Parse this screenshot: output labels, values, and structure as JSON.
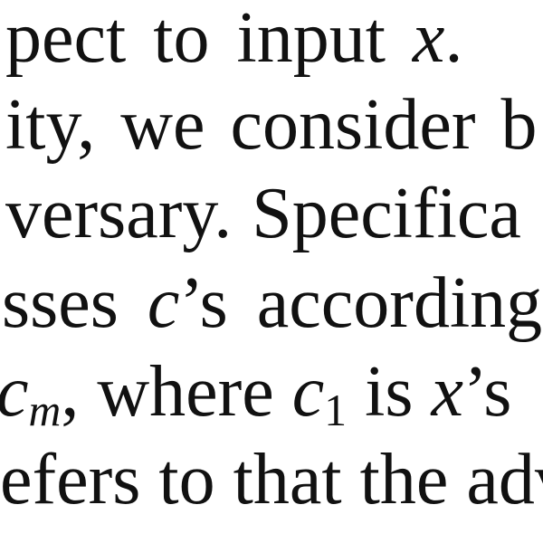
{
  "lines": [
    {
      "a": "pect to input ",
      "b": "x",
      "c": "."
    },
    {
      "a": "ity, we consider b"
    },
    {
      "a": "versary.",
      "b": "Specifica"
    },
    {
      "a": "c",
      "b": "’s according",
      "pre": "sses "
    },
    {
      "c": "c",
      "m": "m",
      "d": ", where ",
      "e": "c",
      "one": "1",
      "f": " is ",
      "x": "x",
      "g": "’s"
    },
    {
      "a": "efers to that the adv"
    }
  ]
}
